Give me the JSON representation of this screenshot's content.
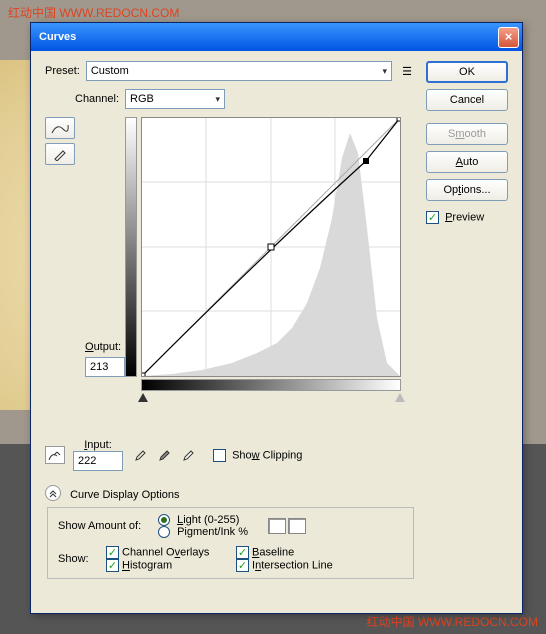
{
  "watermark": {
    "top": "红动中国 WWW.REDOCN.COM",
    "bottom": "红动中国 WWW.REDOCN.COM"
  },
  "dialog": {
    "title": "Curves",
    "preset_label": "Preset:",
    "preset_value": "Custom",
    "channel_label": "Channel:",
    "channel_value": "RGB",
    "output_label": "Output:",
    "output_value": "213",
    "input_label": "Input:",
    "input_value": "222",
    "show_clipping": "Show Clipping",
    "curve_display": "Curve Display Options",
    "show_amount": "Show Amount of:",
    "light": "Light (0-255)",
    "pigment": "Pigment/Ink %",
    "show": "Show:",
    "channel_overlays": "Channel Overlays",
    "histogram": "Histogram",
    "baseline": "Baseline",
    "intersection": "Intersection Line"
  },
  "buttons": {
    "ok": "OK",
    "cancel": "Cancel",
    "smooth": "Smooth",
    "auto": "Auto",
    "options": "Options...",
    "preview": "Preview"
  },
  "chart_data": {
    "type": "line",
    "title": "Curves adjustment",
    "xlabel": "Input",
    "ylabel": "Output",
    "xlim": [
      0,
      255
    ],
    "ylim": [
      0,
      255
    ],
    "grid": true,
    "series": [
      {
        "name": "baseline",
        "x": [
          0,
          255
        ],
        "y": [
          0,
          255
        ]
      },
      {
        "name": "curve",
        "x": [
          0,
          128,
          222,
          255
        ],
        "y": [
          0,
          128,
          213,
          255
        ]
      }
    ],
    "histogram_hint": "background histogram filled area peaking near x≈200"
  }
}
